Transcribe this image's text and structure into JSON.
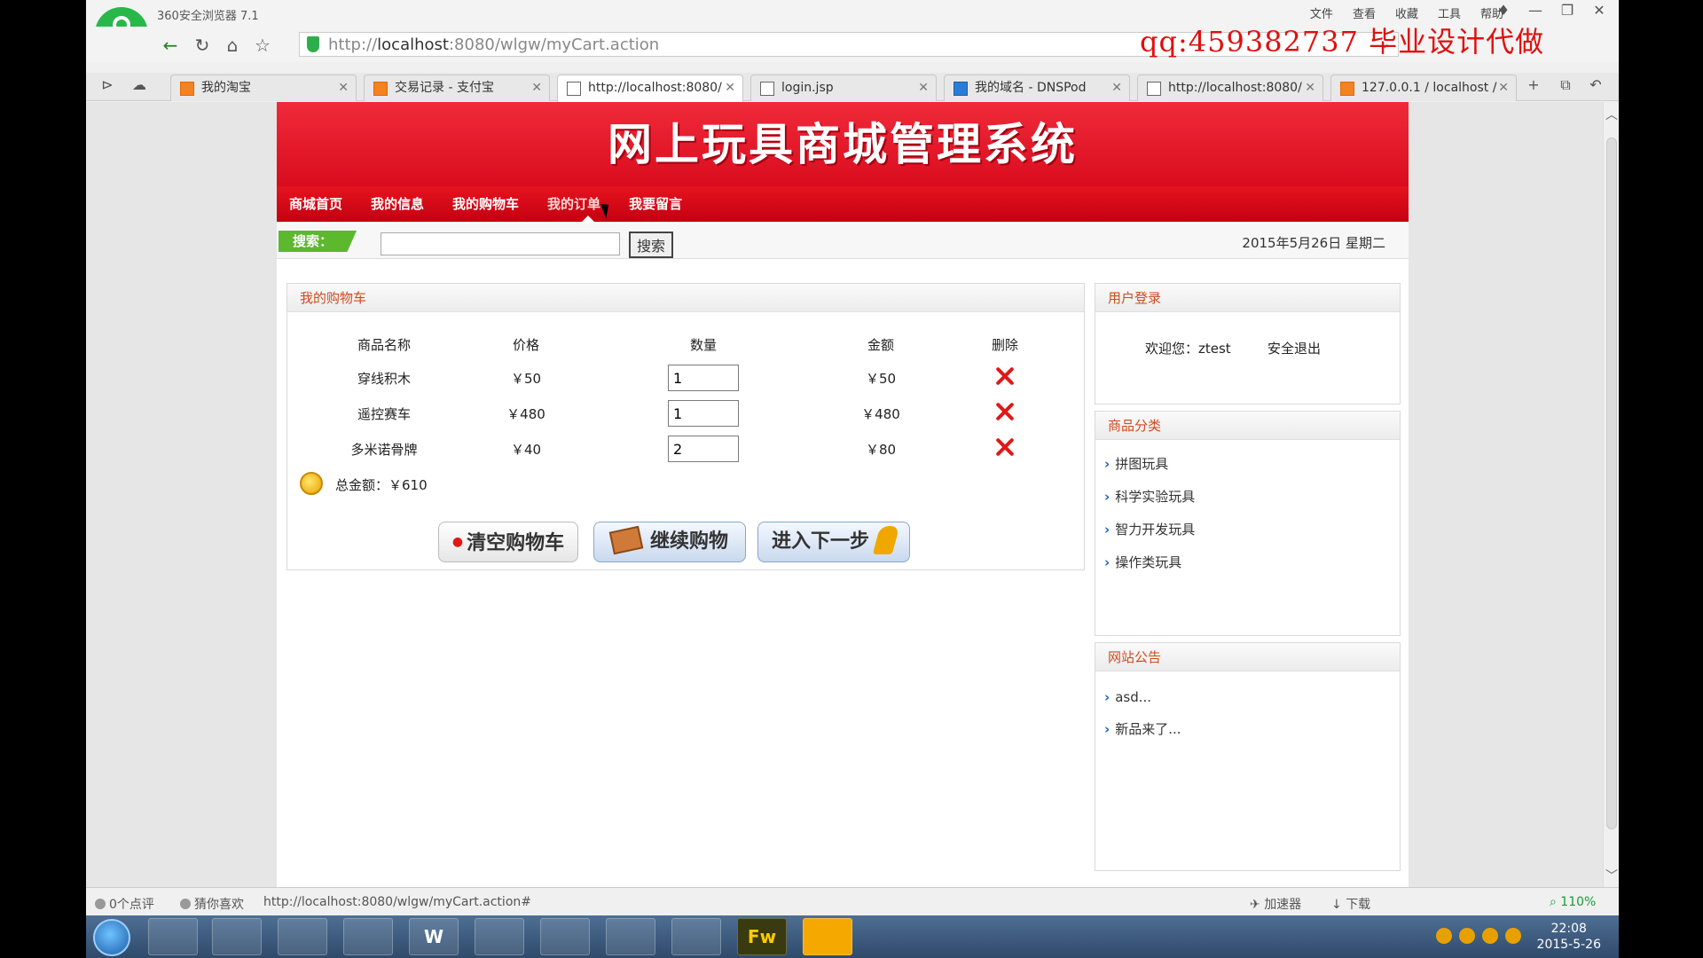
{
  "browser": {
    "app_title": "360安全浏览器 7.1",
    "menu": [
      "文件",
      "查看",
      "收藏",
      "工具",
      "帮助"
    ],
    "address_prefix": "http://",
    "address_host": "localhost",
    "address_rest": ":8080/wlgw/myCart.action",
    "watermark": "qq:459382737 毕业设计代做",
    "tabs": [
      {
        "label": "我的淘宝",
        "icon": "taobao-icon"
      },
      {
        "label": "交易记录 - 支付宝",
        "icon": "alipay-icon"
      },
      {
        "label": "http://localhost:8080/",
        "icon": "page-icon",
        "active": true
      },
      {
        "label": "login.jsp",
        "icon": "page-icon"
      },
      {
        "label": "我的域名 - DNSPod",
        "icon": "dnspod-icon"
      },
      {
        "label": "http://localhost:8080/",
        "icon": "page-icon"
      },
      {
        "label": "127.0.0.1 / localhost /",
        "icon": "pma-icon"
      }
    ],
    "status": {
      "comments": "0个点评",
      "guess": "猜你喜欢",
      "link": "http://localhost:8080/wlgw/myCart.action#",
      "accelerator": "加速器",
      "download": "下载",
      "zoom": "110%"
    }
  },
  "site": {
    "banner_title": "网上玩具商城管理系统",
    "nav": [
      "商城首页",
      "我的信息",
      "我的购物车",
      "我的订单",
      "我要留言"
    ],
    "search_label": "搜索：",
    "search_value": "",
    "search_button": "搜索",
    "date": "2015年5月26日 星期二"
  },
  "cart": {
    "title": "我的购物车",
    "columns": [
      "商品名称",
      "价格",
      "数量",
      "金额",
      "删除"
    ],
    "rows": [
      {
        "name": "穿线积木",
        "price": "￥50",
        "qty": "1",
        "amount": "￥50"
      },
      {
        "name": "遥控赛车",
        "price": "￥480",
        "qty": "1",
        "amount": "￥480"
      },
      {
        "name": "多米诺骨牌",
        "price": "￥40",
        "qty": "2",
        "amount": "￥80"
      }
    ],
    "total": "总金额：￥610",
    "buttons": {
      "clear": "清空购物车",
      "continue": "继续购物",
      "next": "进入下一步"
    }
  },
  "sidebar": {
    "login": {
      "title": "用户登录",
      "welcome": "欢迎您：ztest",
      "logout": "安全退出"
    },
    "category": {
      "title": "商品分类",
      "items": [
        "拼图玩具",
        "科学实验玩具",
        "智力开发玩具",
        "操作类玩具"
      ]
    },
    "notice": {
      "title": "网站公告",
      "items": [
        "asd...",
        "新品来了..."
      ]
    }
  },
  "taskbar": {
    "time": "22:08",
    "date": "2015-5-26",
    "apps": [
      "",
      "",
      "",
      "",
      "W",
      "",
      "",
      "",
      "",
      "Fw",
      ""
    ]
  },
  "colors": {
    "brand_red": "#e01020",
    "search_green": "#5cb82d",
    "panel_title": "#d04a20"
  }
}
